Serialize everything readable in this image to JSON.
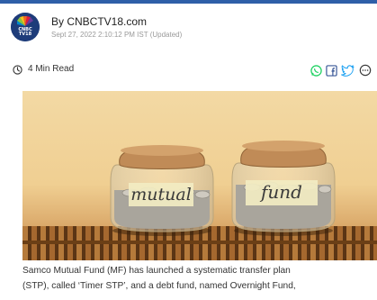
{
  "header": {
    "author": "By CNBCTV18.com",
    "date": "Sept 27, 2022 2:10:12 PM IST (Updated)",
    "logo_text_top": "CNBC",
    "logo_text_bottom": "TV18"
  },
  "meta": {
    "read_time": "4 Min Read",
    "icons": [
      "clock-icon",
      "whatsapp-icon",
      "facebook-icon",
      "twitter-icon",
      "more-icon"
    ]
  },
  "hero": {
    "jar_left_label": "mutual",
    "jar_right_label": "fund"
  },
  "article": {
    "lines": [
      "Samco Mutual Fund (MF) has launched a systematic transfer plan",
      "(STP), called ‘Timer STP’, and a debt fund, named Overnight Fund,"
    ]
  },
  "colors": {
    "accent": "#2f5fa8",
    "whatsapp": "#25d366",
    "facebook": "#3b5998",
    "twitter": "#1da1f2"
  }
}
